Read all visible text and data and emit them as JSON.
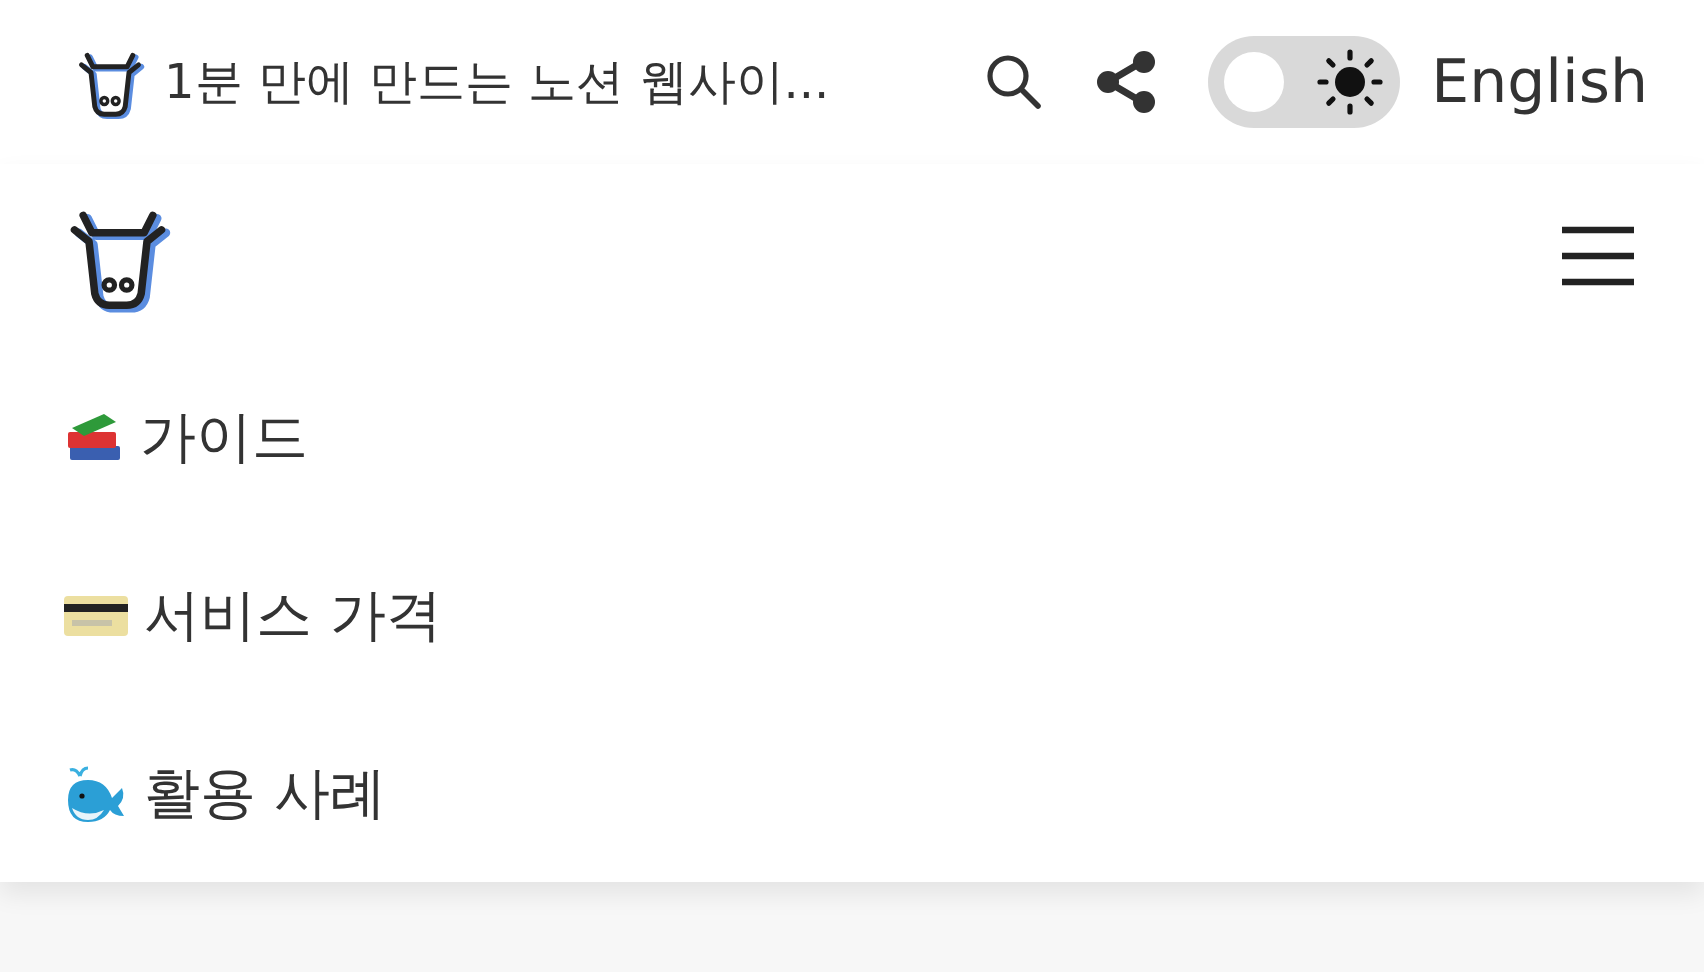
{
  "header": {
    "title": "1분 만에 만드는 노션 웹사이...",
    "language": "English",
    "theme_toggle": {
      "on": false
    }
  },
  "menu": {
    "items": [
      {
        "label": "가이드",
        "kind": "books"
      },
      {
        "label": "서비스 가격",
        "kind": "card"
      },
      {
        "label": "활용 사례",
        "kind": "whale"
      }
    ]
  }
}
